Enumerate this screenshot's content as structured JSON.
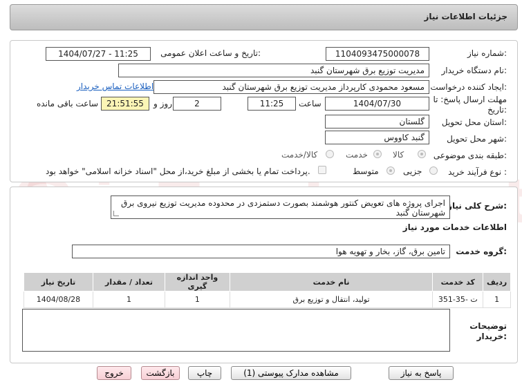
{
  "header": {
    "title": "جزئیات اطلاعات نیاز"
  },
  "labels": {
    "need_number": "شماره نیاز:",
    "announce_datetime": "تاریخ و ساعت اعلان عمومی:",
    "buyer_org": "نام دستگاه خریدار:",
    "requester": "ایجاد کننده درخواست:",
    "contact_link": "اطلاعات تماس خریدار",
    "deadline_line1": "مهلت ارسال پاسخ: تا",
    "deadline_line2": "تاریخ:",
    "time_word": "ساعت",
    "days_and": "روز و",
    "remaining": "ساعت باقی مانده",
    "delivery_province": "استان محل تحویل:",
    "delivery_city": "شهر محل تحویل:",
    "category": "طبقه بندی موضوعی:",
    "process_type": "نوع فرآیند خرید :",
    "general_desc": "شرح کلی نیاز:",
    "services_info": "اطلاعات خدمات مورد نیاز",
    "service_group": "گروه خدمت:",
    "buyer_notes_l1": "توضیحات",
    "buyer_notes_l2": "خریدار:"
  },
  "values": {
    "need_number": "1104093475000078",
    "announce_datetime": "1404/07/27 - 11:25",
    "buyer_org": "مدیریت توزیع برق شهرستان گنبد",
    "requester": "مسعود محمودی کارپرداز مدیریت توزیع برق شهرستان گنبد",
    "deadline_date": "1404/07/30",
    "deadline_time": "11:25",
    "days": "2",
    "remaining_time": "21:51:55",
    "province": "گلستان",
    "city": "گنبد کاووس",
    "general_desc": "اجرای پروژه های تعویض کنتور هوشمند بصورت دستمزدی در محدوده مدیریت توزیع نیروی برق شهرستان گنبد",
    "service_group": "تامین برق، گاز، بخار و تهویه هوا",
    "buyer_notes": ""
  },
  "category_options": [
    {
      "label": "کالا",
      "selected": true
    },
    {
      "label": "خدمت",
      "selected": false
    },
    {
      "label": "کالا/خدمت",
      "selected": false
    }
  ],
  "process_options": [
    {
      "label": "جزیی",
      "selected": false
    },
    {
      "label": "متوسط",
      "selected": true
    }
  ],
  "payment_note": "پرداخت تمام یا بخشی از مبلغ خرید،از محل \"اسناد خزانه اسلامی\" خواهد بود.",
  "table": {
    "headers": [
      "ردیف",
      "کد خدمت",
      "نام خدمت",
      "واحد اندازه گیری",
      "تعداد / مقدار",
      "تاریخ نیاز"
    ],
    "rows": [
      [
        "1",
        "ت -35-351",
        "تولید، انتقال و توزیع برق",
        "1",
        "1",
        "1404/08/28"
      ]
    ]
  },
  "buttons": {
    "reply": "پاسخ به نیاز",
    "attachments": "مشاهده مدارک پیوستی (1)",
    "print": "چاپ",
    "back": "بازگشت",
    "exit": "خروج"
  },
  "watermark": "AriaTender.net",
  "colors": {
    "link": "#1a5fbf",
    "remaining_bg": "#fbf5b6",
    "header_gradient": "#c8c8c8"
  }
}
